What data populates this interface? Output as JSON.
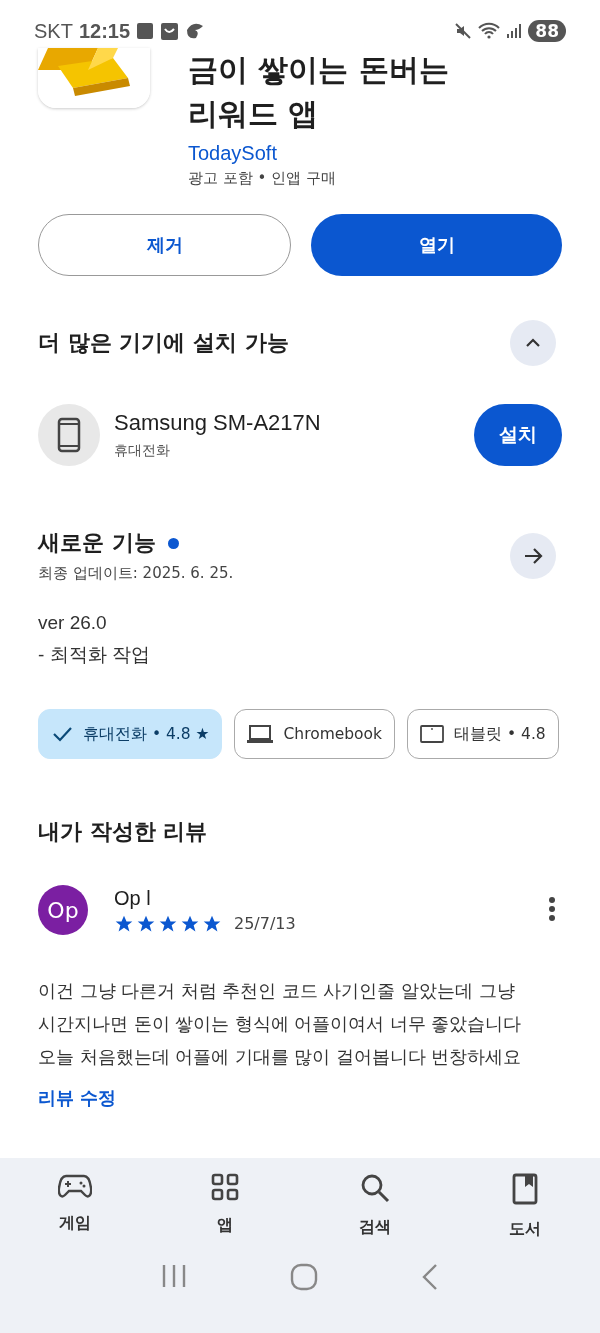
{
  "status_bar": {
    "carrier": "SKT",
    "time": "12:15",
    "battery": "88"
  },
  "app": {
    "title": "금이 쌓이는 돈버는 리워드 앱",
    "developer": "TodaySoft",
    "notes": "광고 포함 • 인앱 구매"
  },
  "actions": [
    {
      "label": "제거",
      "kind": "outline"
    },
    {
      "label": "열기",
      "kind": "filled"
    }
  ],
  "more_devices": {
    "title": "더 많은 기기에 설치 가능",
    "expanded": true,
    "device": {
      "name": "Samsung SM-A217N",
      "type": "휴대전화",
      "button": "설치"
    }
  },
  "whats_new": {
    "title": "새로운 기능",
    "updated": "최종 업데이트: 2025. 6. 25.",
    "lines": [
      "ver 26.0",
      "- 최적화 작업"
    ]
  },
  "device_chips": [
    {
      "label": "휴대전화 • 4.8 ★",
      "selected": true
    },
    {
      "label": "Chromebook",
      "kind": "laptop",
      "selected": false
    },
    {
      "label": "태블릿 • 4.8",
      "kind": "tablet",
      "selected": false
    }
  ],
  "my_review": {
    "title": "내가 작성한 리뷰",
    "avatar": "Op",
    "author": "Op l",
    "stars": 5,
    "date": "25/7/13",
    "text": "이건 그냥 다른거 처럼 추천인 코드 사기인줄 알았는데 그냥 시간지나면 돈이 쌓이는 형식에 어플이여서 너무 좋았습니다 오늘 처음했는데 어플에 기대를 많이 걸어봅니다 번창하세요",
    "edit_link": "리뷰 수정"
  },
  "bottom_nav": [
    {
      "label": "게임",
      "kind": "games",
      "selected": false
    },
    {
      "label": "앱",
      "kind": "apps",
      "selected": false
    },
    {
      "label": "검색",
      "kind": "search",
      "selected": false
    },
    {
      "label": "도서",
      "kind": "books",
      "selected": false
    }
  ]
}
